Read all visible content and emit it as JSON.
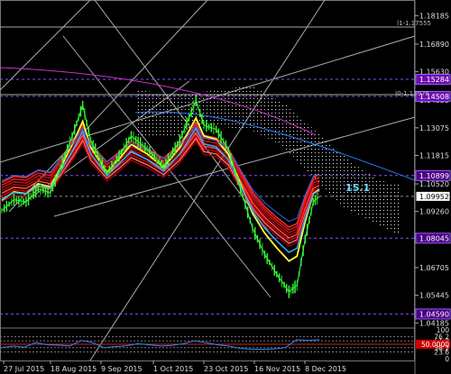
{
  "chart_data": [
    {
      "type": "line",
      "panel": "price",
      "instrument_hint": "EURUSD",
      "y_axis_ticks": [
        "1.18185",
        "1.16890",
        "1.15630",
        "1.14335",
        "1.13075",
        "1.11815",
        "1.10520",
        "1.09260",
        "1.08045",
        "1.06705",
        "1.05445",
        "1.04185"
      ],
      "level_badges": [
        {
          "label": "1.15284",
          "value": 1.15284,
          "color": "#6a0dad"
        },
        {
          "label": "1.14508",
          "value": 1.14508,
          "color": "#6a0dad"
        },
        {
          "label": "1.10899",
          "value": 1.10899,
          "color": "#4b0082"
        },
        {
          "label": "1.09952",
          "value": 1.09952,
          "color": "#ffffff"
        },
        {
          "label": "1.08045",
          "value": 1.08045,
          "color": "#4b0082"
        },
        {
          "label": "1.04590",
          "value": 1.0459,
          "color": "#4b0082"
        }
      ],
      "level_labels": [
        "l1-1.17555",
        "l0-1.13976"
      ],
      "annotation": "15.1",
      "ylim": [
        1.0395,
        1.189
      ],
      "price_series": [
        {
          "x": 0,
          "value": 1.093
        },
        {
          "x": 6,
          "value": 1.098
        },
        {
          "x": 12,
          "value": 1.097
        },
        {
          "x": 18,
          "value": 1.103
        },
        {
          "x": 24,
          "value": 1.101
        },
        {
          "x": 30,
          "value": 1.115
        },
        {
          "x": 36,
          "value": 1.13
        },
        {
          "x": 40,
          "value": 1.141
        },
        {
          "x": 44,
          "value": 1.125
        },
        {
          "x": 52,
          "value": 1.11
        },
        {
          "x": 58,
          "value": 1.118
        },
        {
          "x": 64,
          "value": 1.127
        },
        {
          "x": 72,
          "value": 1.121
        },
        {
          "x": 80,
          "value": 1.113
        },
        {
          "x": 88,
          "value": 1.125
        },
        {
          "x": 96,
          "value": 1.143
        },
        {
          "x": 100,
          "value": 1.132
        },
        {
          "x": 106,
          "value": 1.13
        },
        {
          "x": 112,
          "value": 1.121
        },
        {
          "x": 118,
          "value": 1.103
        },
        {
          "x": 124,
          "value": 1.085
        },
        {
          "x": 130,
          "value": 1.073
        },
        {
          "x": 136,
          "value": 1.064
        },
        {
          "x": 142,
          "value": 1.056
        },
        {
          "x": 146,
          "value": 1.059
        },
        {
          "x": 150,
          "value": 1.08
        },
        {
          "x": 154,
          "value": 1.097
        },
        {
          "x": 157,
          "value": 1.0995
        }
      ]
    },
    {
      "type": "line",
      "panel": "oscillator",
      "y_axis_ticks": [
        "100",
        "76.2",
        "61.8",
        "50.0000",
        "38.2",
        "23.6",
        "0"
      ],
      "ylim": [
        0,
        100
      ],
      "levels": [
        76.2,
        61.8,
        50,
        38.2,
        23.6
      ],
      "values": [
        38,
        44,
        40,
        56,
        48,
        47,
        44,
        63,
        56,
        38,
        42,
        45,
        52,
        48,
        44,
        46,
        52,
        62,
        56,
        48,
        44,
        36,
        33,
        32,
        34,
        38,
        66,
        63,
        66
      ]
    }
  ],
  "x_axis": {
    "tick_labels": [
      "27 Jul 2015",
      "18 Aug 2015",
      "9 Sep 2015",
      "1 Oct 2015",
      "23 Oct 2015",
      "16 Nov 2015",
      "8 Dec 2015"
    ]
  }
}
